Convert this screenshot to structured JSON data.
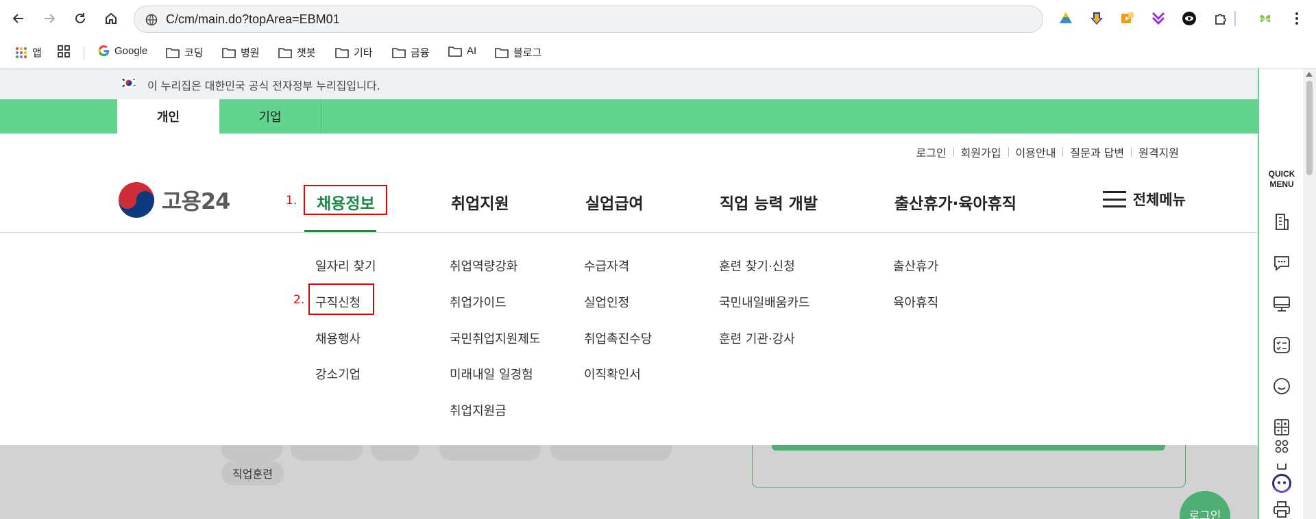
{
  "browser": {
    "url": "C/cm/main.do?topArea=EBM01",
    "bookmarks": [
      "앱",
      "Google",
      "코딩",
      "병원",
      "챗봇",
      "기타",
      "금융",
      "AI",
      "블로그"
    ]
  },
  "gov_banner": {
    "text": "이 누리집은 대한민국 공식 전자정부 누리집입니다."
  },
  "user_tabs": [
    "개인",
    "기업"
  ],
  "util_links": [
    "로그인",
    "회원가입",
    "이용안내",
    "질문과 답변",
    "원격지원"
  ],
  "logo": {
    "text": "고용24"
  },
  "gnb": {
    "items": [
      "채용정보",
      "취업지원",
      "실업급여",
      "직업 능력 개발",
      "출산휴가·육아휴직"
    ],
    "all_menu": "전체메뉴"
  },
  "steps": [
    "1.",
    "2."
  ],
  "submenu": {
    "col1": [
      "일자리 찾기",
      "구직신청",
      "채용행사",
      "강소기업"
    ],
    "col2": [
      "취업역량강화",
      "취업가이드",
      "국민취업지원제도",
      "미래내일 일경험",
      "취업지원금"
    ],
    "col3": [
      "수급자격",
      "실업인정",
      "취업촉진수당",
      "이직확인서"
    ],
    "col4": [
      "훈련 찾기·신청",
      "국민내일배움카드",
      "훈련 기관·강사"
    ],
    "col5": [
      "출산휴가",
      "육아휴직"
    ]
  },
  "background": {
    "pill_training": "직업훈련",
    "login_float": "로그인"
  },
  "quick_menu": {
    "title_line1": "QUICK",
    "title_line2": "MENU"
  }
}
